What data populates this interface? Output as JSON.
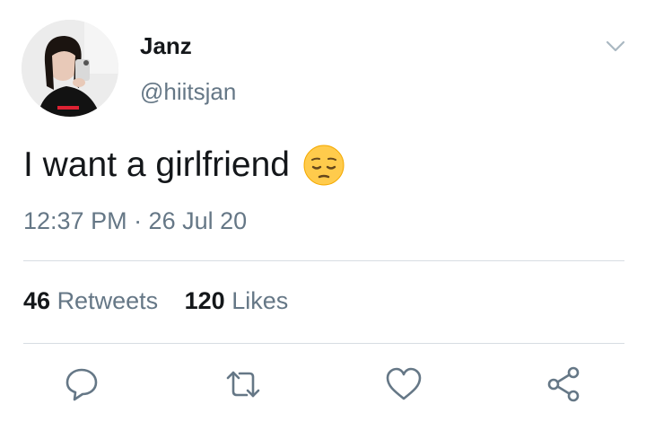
{
  "author": {
    "display_name": "Janz",
    "handle": "@hiitsjan",
    "avatar_icon": "user-avatar-photo",
    "avatar_shirt_print": "SUPREME"
  },
  "tweet": {
    "text": "I want a girlfriend",
    "emoji_icon": "pensive-face-emoji",
    "timestamp": "12:37 PM · 26 Jul 20"
  },
  "stats": {
    "retweets_count": "46",
    "retweets_label": "Retweets",
    "likes_count": "120",
    "likes_label": "Likes"
  },
  "actions": [
    {
      "name": "reply",
      "icon": "reply-bubble-icon"
    },
    {
      "name": "retweet",
      "icon": "retweet-icon"
    },
    {
      "name": "like",
      "icon": "heart-icon"
    },
    {
      "name": "share",
      "icon": "share-icon"
    }
  ],
  "colors": {
    "text_primary": "#14171a",
    "text_secondary": "#657786",
    "divider": "#d7dde2",
    "icon": "#657786"
  }
}
